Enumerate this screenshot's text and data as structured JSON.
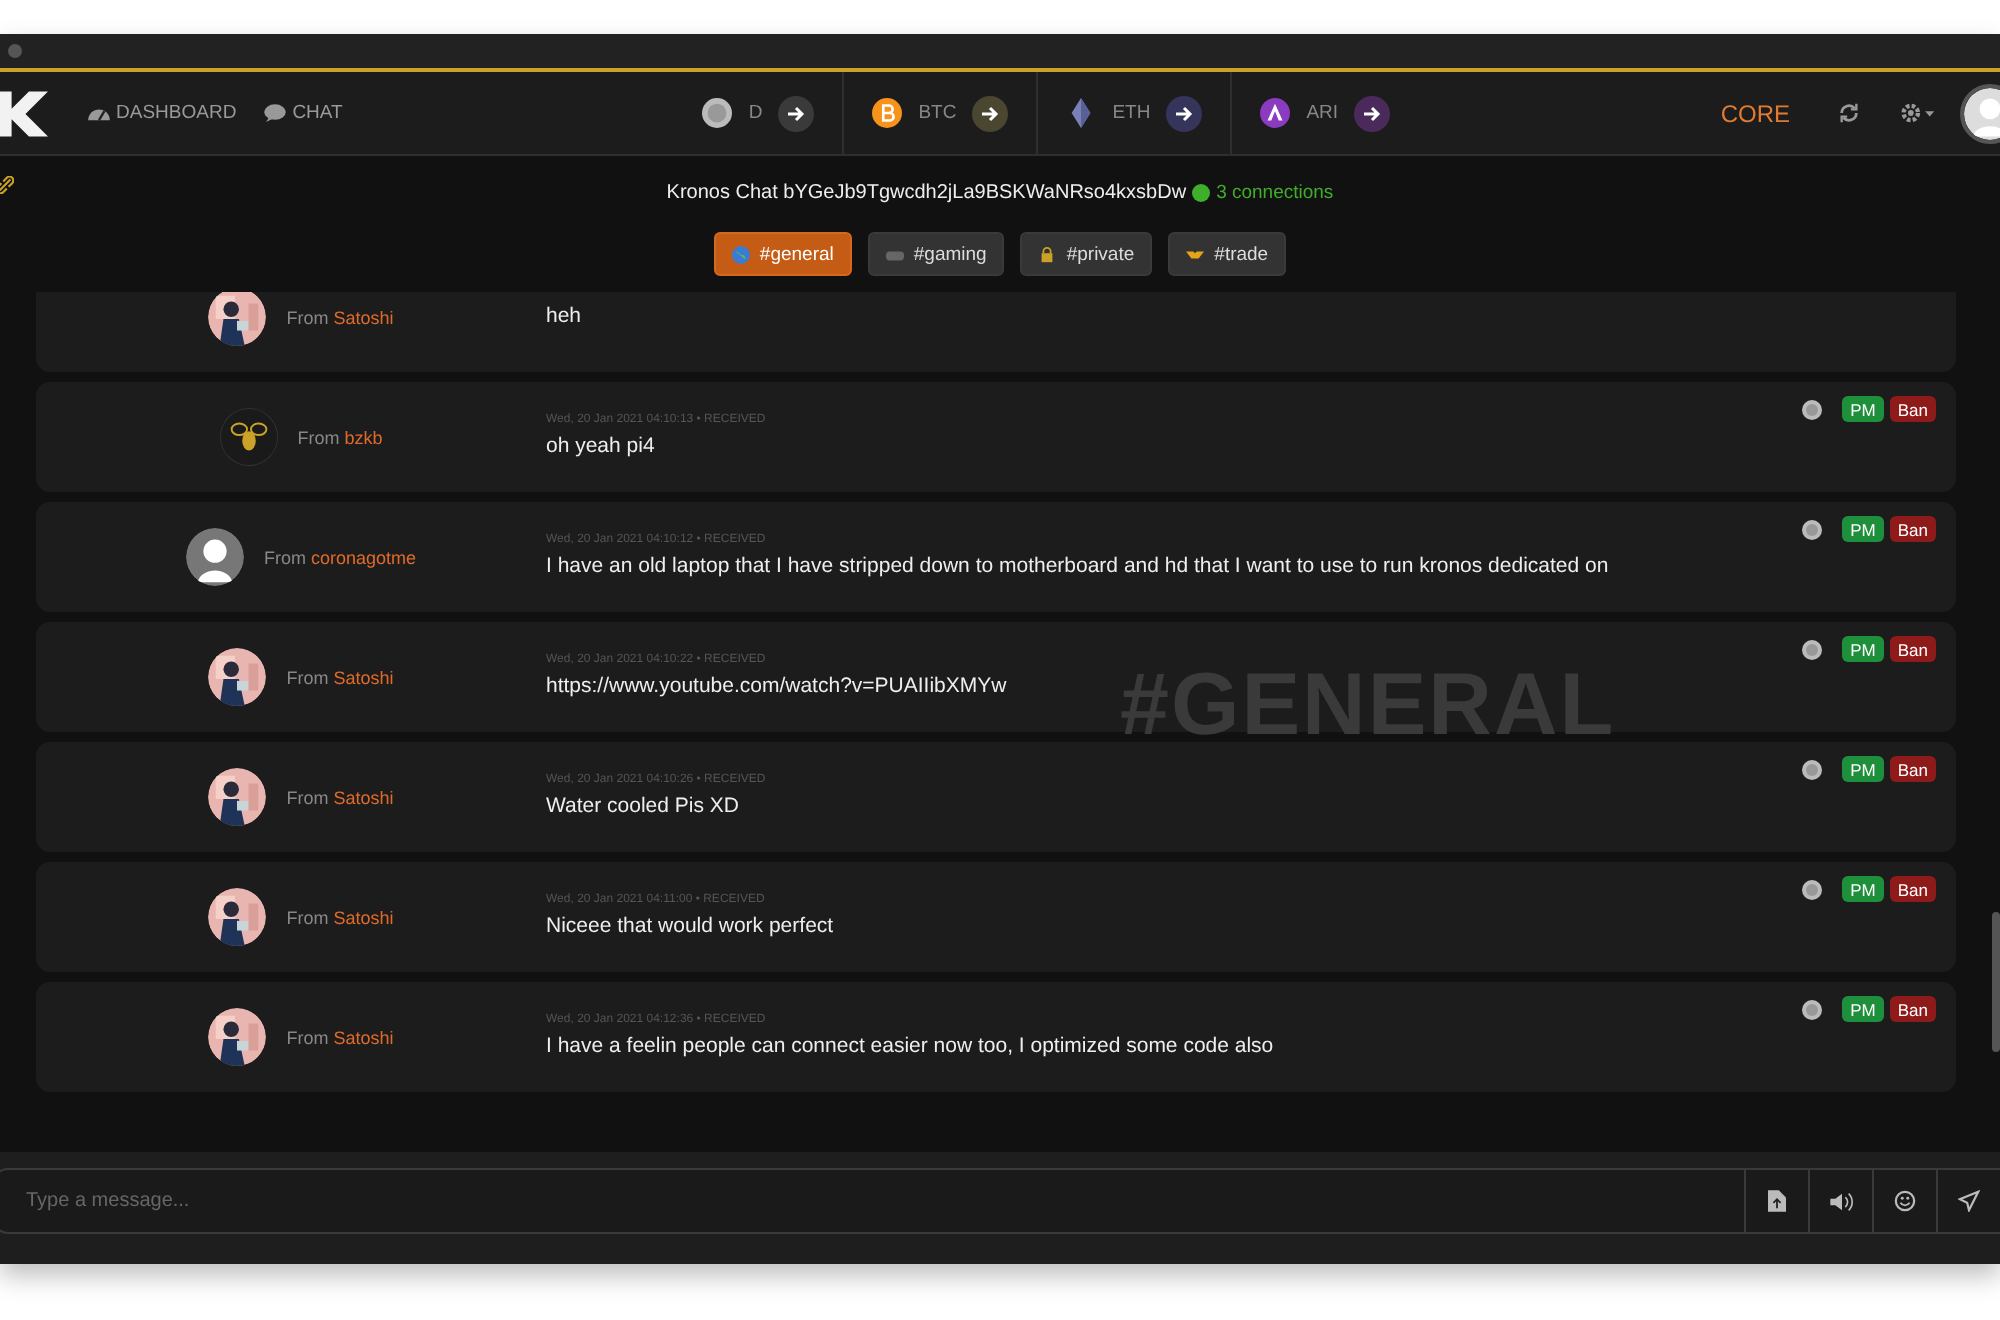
{
  "nav": {
    "links": [
      {
        "label": "DASHBOARD"
      },
      {
        "label": "CHAT"
      }
    ],
    "coins": [
      {
        "symbol": "D",
        "kind": "silver"
      },
      {
        "symbol": "BTC",
        "kind": "btc"
      },
      {
        "symbol": "ETH",
        "kind": "eth"
      },
      {
        "symbol": "ARI",
        "kind": "ari"
      }
    ],
    "core": "CORE"
  },
  "chat": {
    "title": "Kronos Chat bYGeJb9Tgwcdh2jLa9BSKWaNRso4kxsbDw",
    "connections": "3 connections",
    "watermark": "#GENERAL"
  },
  "channels": [
    {
      "label": "#general",
      "selected": true
    },
    {
      "label": "#gaming",
      "selected": false
    },
    {
      "label": "#private",
      "selected": false
    },
    {
      "label": "#trade",
      "selected": false
    }
  ],
  "messages": [
    {
      "from_prefix": "From",
      "user": "Satoshi",
      "text": "heh"
    },
    {
      "from_prefix": "From",
      "user": "bzkb",
      "kind": "bee",
      "time": "Wed, 20 Jan 2021 04:10:13 • RECEIVED",
      "text": "oh yeah pi4",
      "actions": [
        "PM",
        "Ban"
      ]
    },
    {
      "from_prefix": "From",
      "user": "coronagotme",
      "kind": "default",
      "time": "Wed, 20 Jan 2021 04:10:12 • RECEIVED",
      "text": "I have an old laptop that I have stripped down to motherboard and hd that I want to use to run kronos dedicated on",
      "actions": [
        "PM",
        "Ban"
      ]
    },
    {
      "from_prefix": "From",
      "user": "Satoshi",
      "time": "Wed, 20 Jan 2021 04:10:22 • RECEIVED",
      "text": "https://www.youtube.com/watch?v=PUAIIibXMYw",
      "actions": [
        "PM",
        "Ban"
      ]
    },
    {
      "from_prefix": "From",
      "user": "Satoshi",
      "time": "Wed, 20 Jan 2021 04:10:26 • RECEIVED",
      "text": "Water cooled Pis XD",
      "actions": [
        "PM",
        "Ban"
      ]
    },
    {
      "from_prefix": "From",
      "user": "Satoshi",
      "time": "Wed, 20 Jan 2021 04:11:00 • RECEIVED",
      "text": "Niceee that would work perfect",
      "actions": [
        "PM",
        "Ban"
      ]
    },
    {
      "from_prefix": "From",
      "user": "Satoshi",
      "time": "Wed, 20 Jan 2021 04:12:36 • RECEIVED",
      "text": "I have a feelin people can connect easier now too, I optimized some code also",
      "actions": [
        "PM",
        "Ban"
      ]
    }
  ],
  "composer": {
    "placeholder": "Type a message..."
  }
}
